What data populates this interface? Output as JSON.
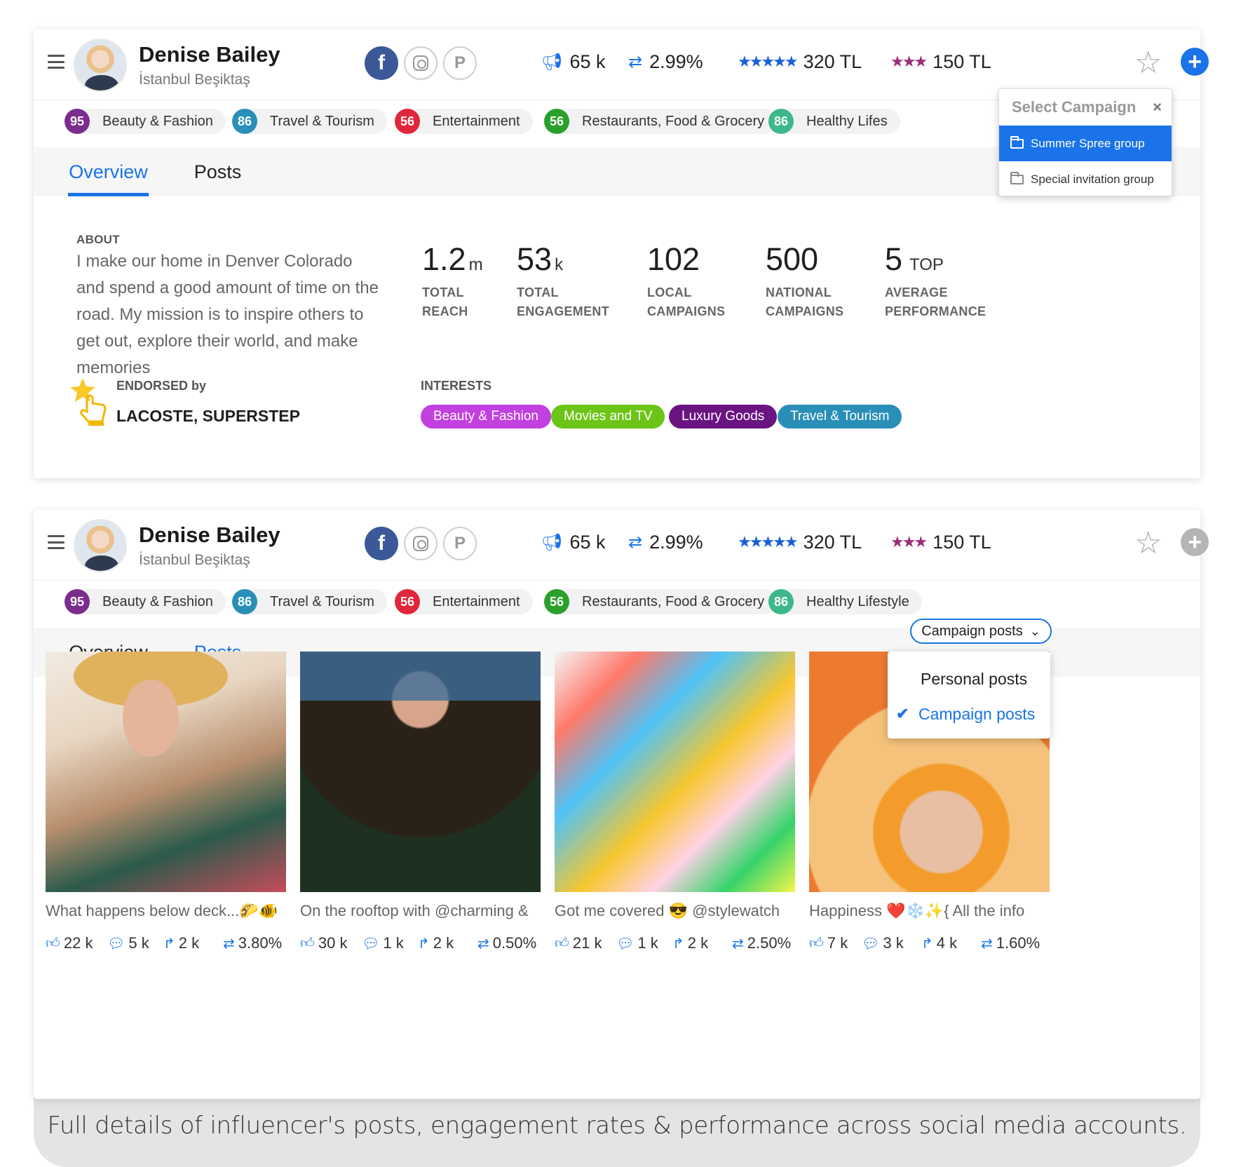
{
  "profile": {
    "name": "Denise Bailey",
    "location": "İstanbul Beşiktaş",
    "reach": "65 k",
    "engagement_rate": "2.99%",
    "price_high": "320 TL",
    "price_low": "150 TL"
  },
  "categories": [
    {
      "score": "95",
      "label": "Beauty & Fashion",
      "color": "#7b2d8e"
    },
    {
      "score": "86",
      "label": "Travel & Tourism",
      "color": "#2a8fb8"
    },
    {
      "score": "56",
      "label": "Entertainment",
      "color": "#e0263a"
    },
    {
      "score": "56",
      "label": "Restaurants, Food & Grocery",
      "color": "#2aa02a"
    },
    {
      "score": "86",
      "label": "Healthy Lifestyle",
      "color": "#3db88a"
    }
  ],
  "categories_truncated_label": "Healthy Lifes",
  "tabs": {
    "overview": "Overview",
    "posts": "Posts"
  },
  "overview": {
    "about_label": "ABOUT",
    "about_text": "I make our home in Denver Colorado and spend a good amount of time on the road. My mission is to inspire others to get out, explore their world, and make memories",
    "metrics": [
      {
        "value": "1.2",
        "unit": "m",
        "label1": "TOTAL",
        "label2": "REACH"
      },
      {
        "value": "53",
        "unit": "k",
        "label1": "TOTAL",
        "label2": "ENGAGEMENT"
      },
      {
        "value": "102",
        "unit": "",
        "label1": "LOCAL",
        "label2": "CAMPAIGNS"
      },
      {
        "value": "500",
        "unit": "",
        "label1": "NATIONAL",
        "label2": "CAMPAIGNS"
      },
      {
        "value": "5",
        "unit": "TOP",
        "label1": "AVERAGE",
        "label2": "PERFORMANCE"
      }
    ],
    "endorsed_label": "ENDORSED by",
    "endorsed_value": "LACOSTE, SUPERSTEP",
    "interests_label": "INTERESTS",
    "interests": [
      {
        "label": "Beauty & Fashion",
        "color": "#c23fe0"
      },
      {
        "label": "Movies and TV",
        "color": "#6cc417"
      },
      {
        "label": "Luxury Goods",
        "color": "#6a1482"
      },
      {
        "label": "Travel & Tourism",
        "color": "#2a8fb8"
      }
    ]
  },
  "campaign_dropdown": {
    "title": "Select Campaign",
    "close": "×",
    "items": [
      "Summer Spree group",
      "Special invitation group"
    ],
    "selected": "Summer Spree group"
  },
  "posts_filter": {
    "current": "Campaign posts",
    "options": [
      "Personal posts",
      "Campaign posts"
    ],
    "checked": "Campaign posts"
  },
  "posts": [
    {
      "caption": "What happens below deck...🌮🐠",
      "likes": "22 k",
      "comments": "5 k",
      "shares": "2 k",
      "rate": "3.80%"
    },
    {
      "caption": "On the rooftop with @charming &",
      "likes": "30 k",
      "comments": "1 k",
      "shares": "2 k",
      "rate": "0.50%"
    },
    {
      "caption": "Got me covered 😎 @stylewatch",
      "likes": "21 k",
      "comments": "1 k",
      "shares": "2 k",
      "rate": "2.50%"
    },
    {
      "caption": "Happiness ❤️❄️✨{ All the info",
      "likes": "7 k",
      "comments": "3 k",
      "shares": "4 k",
      "rate": "1.60%"
    }
  ],
  "footer": "Full details of influencer's posts, engagement rates & performance across social media accounts.",
  "icons": {
    "menu": "hamburger-icon",
    "facebook": "facebook-icon",
    "instagram": "instagram-icon",
    "pinterest": "pinterest-icon",
    "reach": "megaphone-icon",
    "engagement": "swap-icon",
    "favorite": "star-icon",
    "add": "plus-circle-icon",
    "like": "thumbs-up-icon",
    "comment": "comment-icon",
    "share": "share-icon"
  },
  "colors": {
    "accent": "#1a73e8",
    "stars_high": "#1a5fd8",
    "stars_low": "#9c2b7a"
  }
}
